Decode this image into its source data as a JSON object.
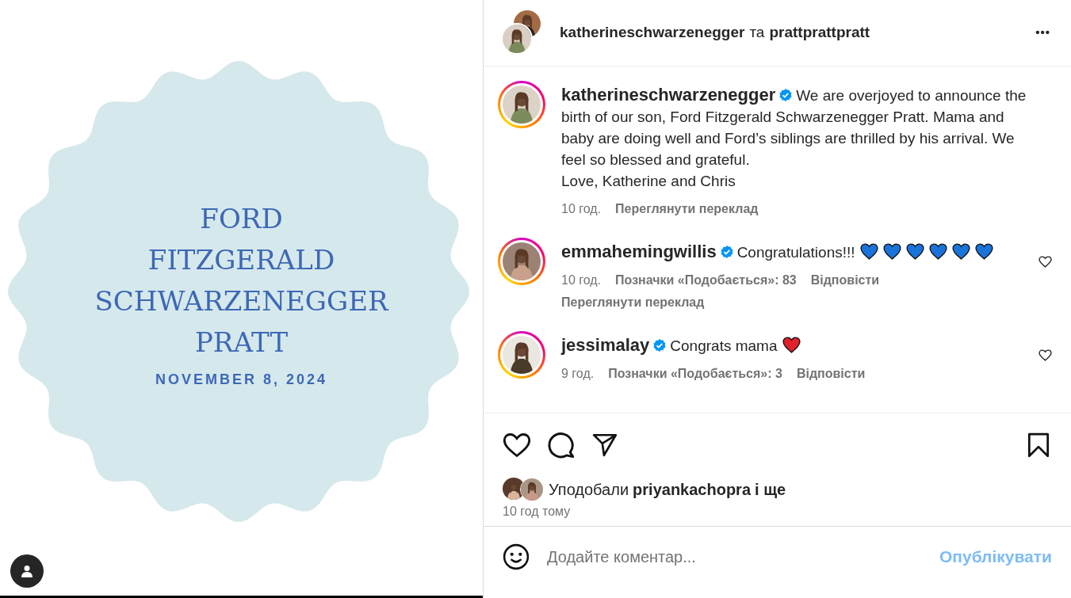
{
  "post_image": {
    "lines": [
      "FORD",
      "FITZGERALD",
      "SCHWARZENEGGER",
      "PRATT"
    ],
    "date": "NOVEMBER 8, 2024"
  },
  "header": {
    "author": "katherineschwarzenegger",
    "joiner": "та",
    "coauthor": "prattprattpratt",
    "more": "•••"
  },
  "caption": {
    "username": "katherineschwarzenegger",
    "verified": true,
    "text": "We are overjoyed  to announce the birth of our son, Ford Fitzgerald Schwarzenegger Pratt. Mama and baby are doing well and Ford’s siblings are thrilled by his arrival. We feel so blessed and grateful.\nLove, Katherine and Chris",
    "time": "10 год.",
    "translate": "Переглянути переклад"
  },
  "comments": [
    {
      "username": "emmahemingwillis",
      "verified": true,
      "text": "Congratulations!!!",
      "emoji": [
        {
          "kind": "heart",
          "color": "#1a73d9"
        },
        {
          "kind": "heart",
          "color": "#1a73d9"
        },
        {
          "kind": "heart",
          "color": "#1a73d9"
        },
        {
          "kind": "heart",
          "color": "#1a73d9"
        },
        {
          "kind": "heart",
          "color": "#1a73d9"
        },
        {
          "kind": "heart",
          "color": "#1a73d9"
        }
      ],
      "time": "10 год.",
      "likes": "Позначки «Подобається»: 83",
      "reply": "Відповісти",
      "translate": "Переглянути переклад"
    },
    {
      "username": "jessimalay",
      "verified": true,
      "text": "Congrats mama",
      "emoji": [
        {
          "kind": "heart",
          "color": "#e0202a"
        }
      ],
      "time": "9 год.",
      "likes": "Позначки «Подобається»: 3",
      "reply": "Відповісти"
    }
  ],
  "likes": {
    "prefix": "Уподобали",
    "user": "priyankachopra",
    "suffix": "і ще"
  },
  "posted": "10 год тому",
  "comment_box": {
    "placeholder": "Додайте коментар...",
    "submit": "Опублікувати"
  }
}
